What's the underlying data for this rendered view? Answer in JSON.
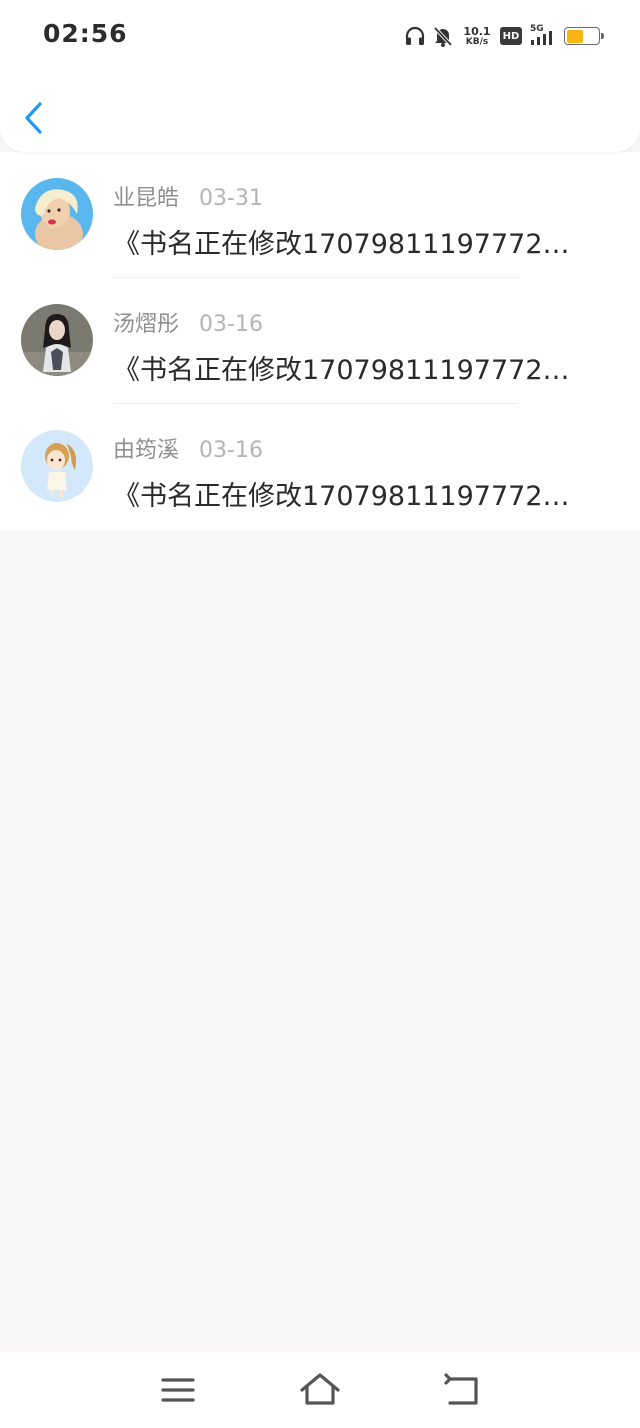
{
  "status_bar": {
    "time": "02:56",
    "speed_value": "10.1",
    "speed_unit": "KB/s",
    "hd": "HD",
    "network": "5G",
    "icons": [
      "headphones-icon",
      "mute-bell-icon",
      "signal-icon",
      "battery-icon"
    ],
    "battery_level": 0.58
  },
  "header": {
    "back_icon": "chevron-left-icon",
    "accent_color": "#2196f3"
  },
  "messages": [
    {
      "name": "业昆皓",
      "date": "03-31",
      "text": "《书名正在修改17079811197772…"
    },
    {
      "name": "汤熠彤",
      "date": "03-16",
      "text": "《书名正在修改17079811197772…"
    },
    {
      "name": "由筠溪",
      "date": "03-16",
      "text": "《书名正在修改17079811197772…"
    }
  ],
  "nav": {
    "icons": [
      "menu-icon",
      "home-icon",
      "back-icon"
    ]
  }
}
